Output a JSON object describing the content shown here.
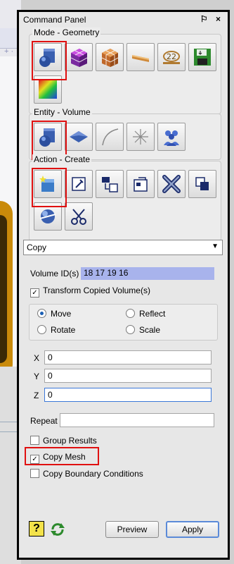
{
  "panel": {
    "title": "Command Panel",
    "controls": "⚐ ×"
  },
  "mode": {
    "title": "Mode - Geometry",
    "buttons": [
      "geometry-mode",
      "mesh-mode",
      "block-mode",
      "boundary-mode",
      "variables-mode",
      "save-mode",
      "results-mode"
    ]
  },
  "entity": {
    "title": "Entity - Volume",
    "buttons": [
      "volume",
      "surface",
      "curve",
      "vertex",
      "group"
    ]
  },
  "action": {
    "title": "Action - Create",
    "buttons": [
      "create",
      "modify",
      "transform",
      "properties",
      "delete",
      "copy",
      "webcut",
      "tear"
    ]
  },
  "operation": {
    "selected": "Copy"
  },
  "form": {
    "volume_ids_label": "Volume ID(s)",
    "volume_ids_value": "18 17 19 16",
    "transform_label": "Transform Copied Volume(s)",
    "transform_checked": true,
    "move_label": "Move",
    "reflect_label": "Reflect",
    "rotate_label": "Rotate",
    "scale_label": "Scale",
    "selected_option": "Move",
    "x_label": "X",
    "x_value": "0",
    "y_label": "Y",
    "y_value": "0",
    "z_label": "Z",
    "z_value": "0",
    "repeat_label": "Repeat",
    "repeat_value": "",
    "group_results_label": "Group Results",
    "group_results_checked": false,
    "copy_mesh_label": "Copy Mesh",
    "copy_mesh_checked": true,
    "copy_bc_label": "Copy Boundary Conditions",
    "copy_bc_checked": false
  },
  "footer": {
    "help_glyph": "?",
    "preview_label": "Preview",
    "apply_label": "Apply"
  },
  "colors": {
    "highlight": "#e01010",
    "selection": "#a8b3ec",
    "accent": "#5b8ad8"
  }
}
